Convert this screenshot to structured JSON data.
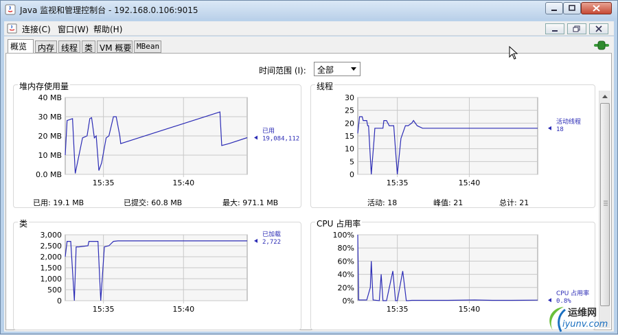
{
  "window": {
    "title": "Java 监视和管理控制台 - 192.168.0.106:9015"
  },
  "menu": {
    "items": [
      "连接(C)",
      "窗口(W)",
      "帮助(H)"
    ]
  },
  "tabs": [
    "概览",
    "内存",
    "线程",
    "类",
    "VM 概要",
    "MBean"
  ],
  "active_tab": "概览",
  "time_range": {
    "label": "时间范围 (I):",
    "value": "全部"
  },
  "colors": {
    "series": "#2b2bb5",
    "grid": "#c8c8c8",
    "plot_bg": "#f6f6f6"
  },
  "panels": {
    "heap": {
      "title": "堆内存使用量",
      "legend": {
        "label": "已用",
        "value": "19,084,112"
      },
      "stats": {
        "used": "已用: 19.1 MB",
        "committed": "已提交: 60.8 MB",
        "max": "最大: 971.1 MB"
      }
    },
    "threads": {
      "title": "线程",
      "legend": {
        "label": "活动线程",
        "value": "18"
      },
      "stats": {
        "live": "活动: 18",
        "peak": "峰值: 21",
        "total": "总计: 21"
      }
    },
    "classes": {
      "title": "类",
      "legend": {
        "label": "已加载",
        "value": "2,722"
      }
    },
    "cpu": {
      "title": "CPU 占用率",
      "legend": {
        "label": "CPU 占用率",
        "value": "0.8%"
      }
    }
  },
  "watermark": {
    "name": "运维网",
    "url": "iyunv.com"
  },
  "chart_data": [
    {
      "id": "heap",
      "type": "line",
      "title": "堆内存使用量",
      "x_ticks": [
        "15:35",
        "15:40"
      ],
      "x_tick_pos": [
        0.21,
        0.65
      ],
      "y_ticks": [
        "0.0 MB",
        "10 MB",
        "20 MB",
        "30 MB",
        "40 MB"
      ],
      "ylim": [
        0,
        40
      ],
      "series": [
        {
          "name": "已用",
          "x": [
            0.0,
            0.01,
            0.04,
            0.055,
            0.095,
            0.12,
            0.135,
            0.145,
            0.16,
            0.17,
            0.185,
            0.2,
            0.225,
            0.24,
            0.265,
            0.28,
            0.3,
            0.305,
            0.85,
            0.86,
            0.9,
            1.0
          ],
          "y": [
            10,
            28,
            29,
            0.5,
            19,
            20,
            29,
            29.5,
            19,
            20,
            2,
            6,
            19,
            20,
            30,
            30,
            20,
            16,
            32.5,
            15,
            16,
            19.1
          ]
        }
      ]
    },
    {
      "id": "threads",
      "type": "line",
      "title": "线程",
      "x_ticks": [
        "15:35",
        "15:40"
      ],
      "x_tick_pos": [
        0.22,
        0.62
      ],
      "y_ticks": [
        "0",
        "5",
        "10",
        "15",
        "20",
        "25",
        "30"
      ],
      "ylim": [
        0,
        30
      ],
      "series": [
        {
          "name": "活动线程",
          "x": [
            0.0,
            0.01,
            0.025,
            0.03,
            0.05,
            0.055,
            0.06,
            0.075,
            0.09,
            0.095,
            0.14,
            0.145,
            0.16,
            0.175,
            0.2,
            0.22,
            0.24,
            0.265,
            0.28,
            0.3,
            0.31,
            0.33,
            0.36,
            1.0
          ],
          "y": [
            16,
            22.5,
            22.5,
            21,
            21,
            19,
            19,
            0,
            13,
            18,
            18,
            21,
            21,
            19,
            19,
            0,
            14,
            19,
            19,
            20,
            21,
            19,
            18,
            18
          ]
        }
      ]
    },
    {
      "id": "classes",
      "type": "line",
      "title": "类",
      "x_ticks": [
        "15:35",
        "15:40"
      ],
      "x_tick_pos": [
        0.21,
        0.65
      ],
      "y_ticks": [
        "0",
        "500",
        "1,000",
        "1,500",
        "2,000",
        "2,500",
        "3,000"
      ],
      "ylim": [
        0,
        3000
      ],
      "series": [
        {
          "name": "已加载",
          "x": [
            0.0,
            0.01,
            0.03,
            0.05,
            0.06,
            0.075,
            0.125,
            0.13,
            0.18,
            0.195,
            0.215,
            0.24,
            0.265,
            0.29,
            1.0
          ],
          "y": [
            2000,
            2700,
            2700,
            0,
            2450,
            2450,
            2500,
            2700,
            2700,
            0,
            2450,
            2500,
            2700,
            2722,
            2722
          ]
        }
      ]
    },
    {
      "id": "cpu",
      "type": "line",
      "title": "CPU 占用率",
      "x_ticks": [
        "15:35",
        "15:40"
      ],
      "x_tick_pos": [
        0.22,
        0.62
      ],
      "y_ticks": [
        "0%",
        "20%",
        "40%",
        "60%",
        "80%",
        "100%"
      ],
      "ylim": [
        0,
        100
      ],
      "series": [
        {
          "name": "CPU 占用率",
          "x": [
            0.0,
            0.005,
            0.02,
            0.05,
            0.07,
            0.075,
            0.085,
            0.12,
            0.13,
            0.14,
            0.16,
            0.195,
            0.21,
            0.22,
            0.25,
            0.27,
            0.28,
            0.3,
            0.4,
            0.5,
            0.65,
            0.75,
            0.85,
            1.0
          ],
          "y": [
            100,
            1,
            1,
            1,
            20,
            60,
            1,
            0,
            40,
            0,
            0,
            45,
            0,
            0,
            45,
            0,
            0,
            0.5,
            0.5,
            0.5,
            1,
            0.5,
            0.5,
            0.8
          ]
        }
      ]
    }
  ]
}
